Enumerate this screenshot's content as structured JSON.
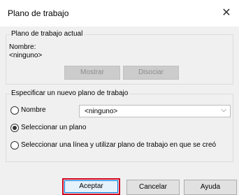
{
  "window": {
    "title": "Plano de trabajo",
    "close_glyph": "✕"
  },
  "current_group": {
    "caption": "Plano de trabajo actual",
    "name_label": "Nombre:",
    "name_value": "<ninguno>",
    "show_button": "Mostrar",
    "dissociate_button": "Disociar"
  },
  "new_group": {
    "caption": "Especificar un nuevo plano de trabajo",
    "name_option": {
      "label": "Nombre",
      "selected": false
    },
    "name_dropdown": {
      "value": "<ninguno>",
      "chevron": "⌵"
    },
    "pick_plane_option": {
      "label": "Seleccionar un plano",
      "selected": true
    },
    "pick_line_option": {
      "label": "Seleccionar una línea y utilizar plano de trabajo en que se creó",
      "selected": false
    }
  },
  "footer": {
    "ok_button": "Aceptar",
    "cancel_button": "Cancelar",
    "help_button": "Ayuda"
  },
  "colors": {
    "focus_highlight": "#d0021b",
    "focus_ring": "#0078d7",
    "dialog_bg": "#f0f0f0"
  }
}
